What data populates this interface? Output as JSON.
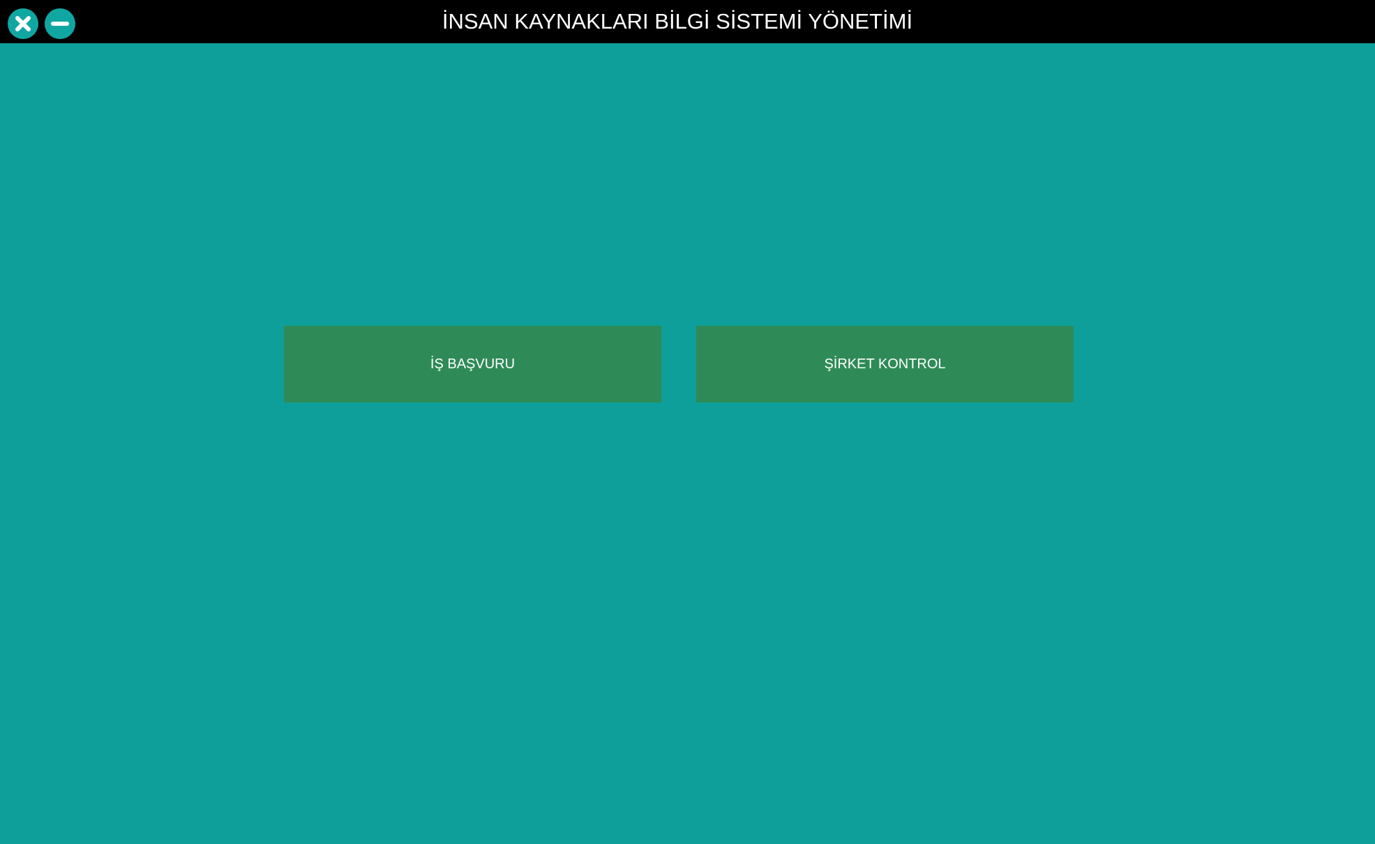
{
  "window": {
    "title": "İNSAN KAYNAKLARI BİLGİ SİSTEMİ YÖNETİMİ",
    "controls": [
      {
        "icon": "close-icon"
      },
      {
        "icon": "minimize-icon"
      }
    ]
  },
  "main": {
    "buttons": [
      {
        "label": "İŞ BAŞVURU"
      },
      {
        "label": "ŞİRKET KONTROL"
      }
    ]
  },
  "colors": {
    "background": "#0E9F9B",
    "titlebar": "#000000",
    "button": "#2E8B57",
    "button_text": "#FFFFFF"
  }
}
